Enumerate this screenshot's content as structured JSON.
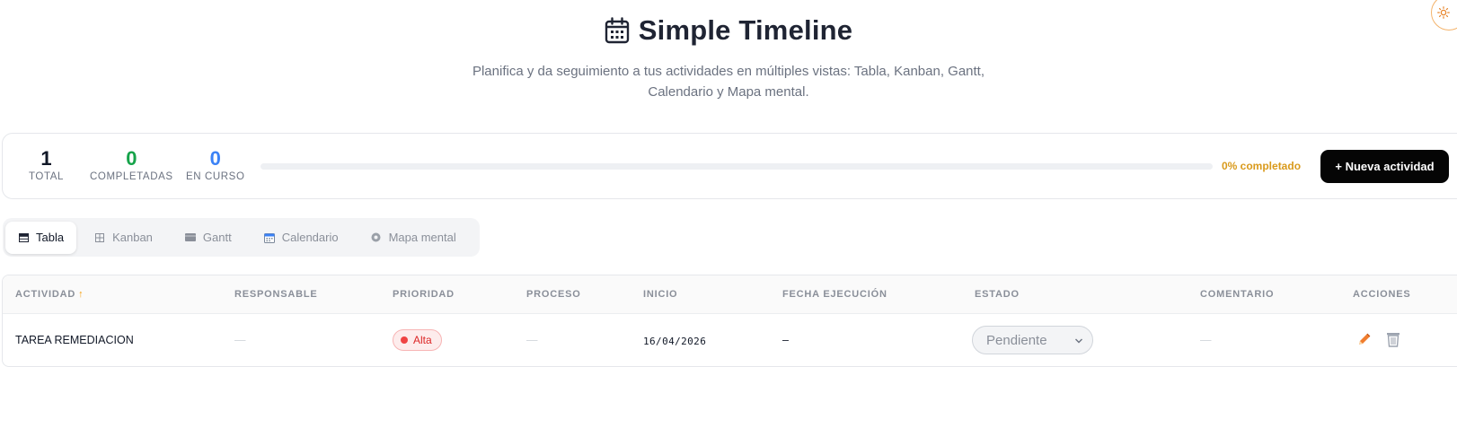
{
  "header": {
    "title": "Simple Timeline",
    "subtitle": "Planifica y da seguimiento a tus actividades en múltiples vistas: Tabla, Kanban, Gantt, Calendario y Mapa mental."
  },
  "stats": {
    "total_value": "1",
    "total_label": "TOTAL",
    "completed_value": "0",
    "completed_label": "COMPLETADAS",
    "in_progress_value": "0",
    "in_progress_label": "EN CURSO",
    "progress_percent": 0,
    "progress_text": "0% completado",
    "new_activity_label": "+ Nueva actividad"
  },
  "tabs": [
    {
      "label": "Tabla",
      "icon": "table-icon",
      "active": true
    },
    {
      "label": "Kanban",
      "icon": "kanban-icon",
      "active": false
    },
    {
      "label": "Gantt",
      "icon": "gantt-icon",
      "active": false
    },
    {
      "label": "Calendario",
      "icon": "calendar-icon",
      "active": false
    },
    {
      "label": "Mapa mental",
      "icon": "mind-map-icon",
      "active": false
    }
  ],
  "table": {
    "columns": [
      "ACTIVIDAD",
      "RESPONSABLE",
      "PRIORIDAD",
      "PROCESO",
      "INICIO",
      "FECHA EJECUCIÓN",
      "ESTADO",
      "COMENTARIO",
      "ACCIONES"
    ],
    "sort_indicator": "↑",
    "rows": [
      {
        "activity": "TAREA REMEDIACION",
        "responsible": "—",
        "priority": "Alta",
        "process": "—",
        "start": "16/04/2026",
        "execution_date": "–",
        "status": "Pendiente",
        "comment": "—"
      }
    ]
  },
  "colors": {
    "completed": "#16a34a",
    "in_progress": "#3b82f6",
    "progress_text": "#d99a1c",
    "priority_high": "#dc2626",
    "edit_icon": "#ea7a2a"
  },
  "icons": {
    "header": "calendar-icon",
    "theme_toggle": "sun-icon",
    "edit": "pencil-icon",
    "delete": "trash-icon"
  }
}
